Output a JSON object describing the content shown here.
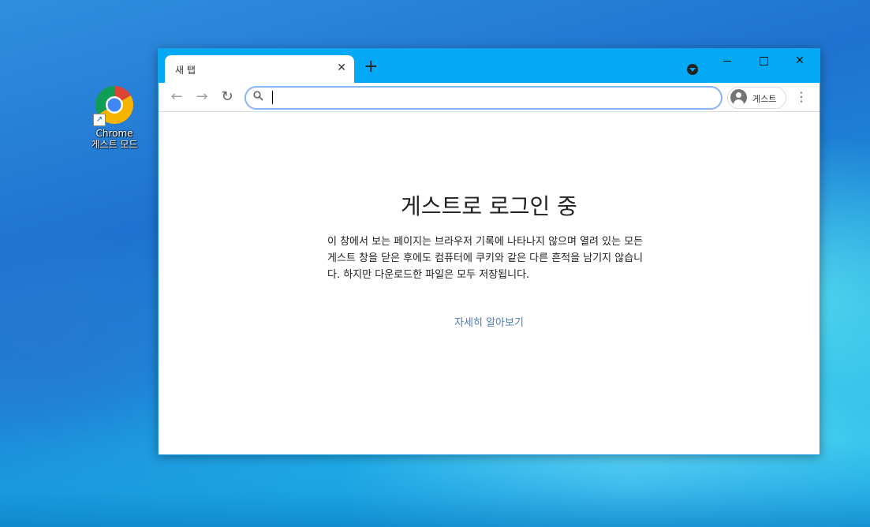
{
  "desktop": {
    "icon_label_line1": "Chrome",
    "icon_label_line2": "게스트 모드",
    "shortcut_arrow": "↗"
  },
  "window": {
    "tab_title": "새 탭",
    "tab_close": "✕",
    "new_tab": "+",
    "close_glyph": "✕",
    "accent_color": "#03a9f4"
  },
  "toolbar": {
    "back": "←",
    "forward": "→",
    "reload": "↻",
    "search_glyph": "⚲",
    "omnibox_value": "",
    "profile_label": "게스트",
    "menu": "⋮"
  },
  "page": {
    "heading": "게스트로 로그인 중",
    "body": "이 창에서 보는 페이지는 브라우저 기록에 나타나지 않으며 열려 있는 모든 게스트 창을 닫은 후에도 컴퓨터에 쿠키와 같은 다른 흔적을 남기지 않습니다. 하지만 다운로드한 파일은 모두 저장됩니다.",
    "learn_more": "자세히 알아보기"
  }
}
